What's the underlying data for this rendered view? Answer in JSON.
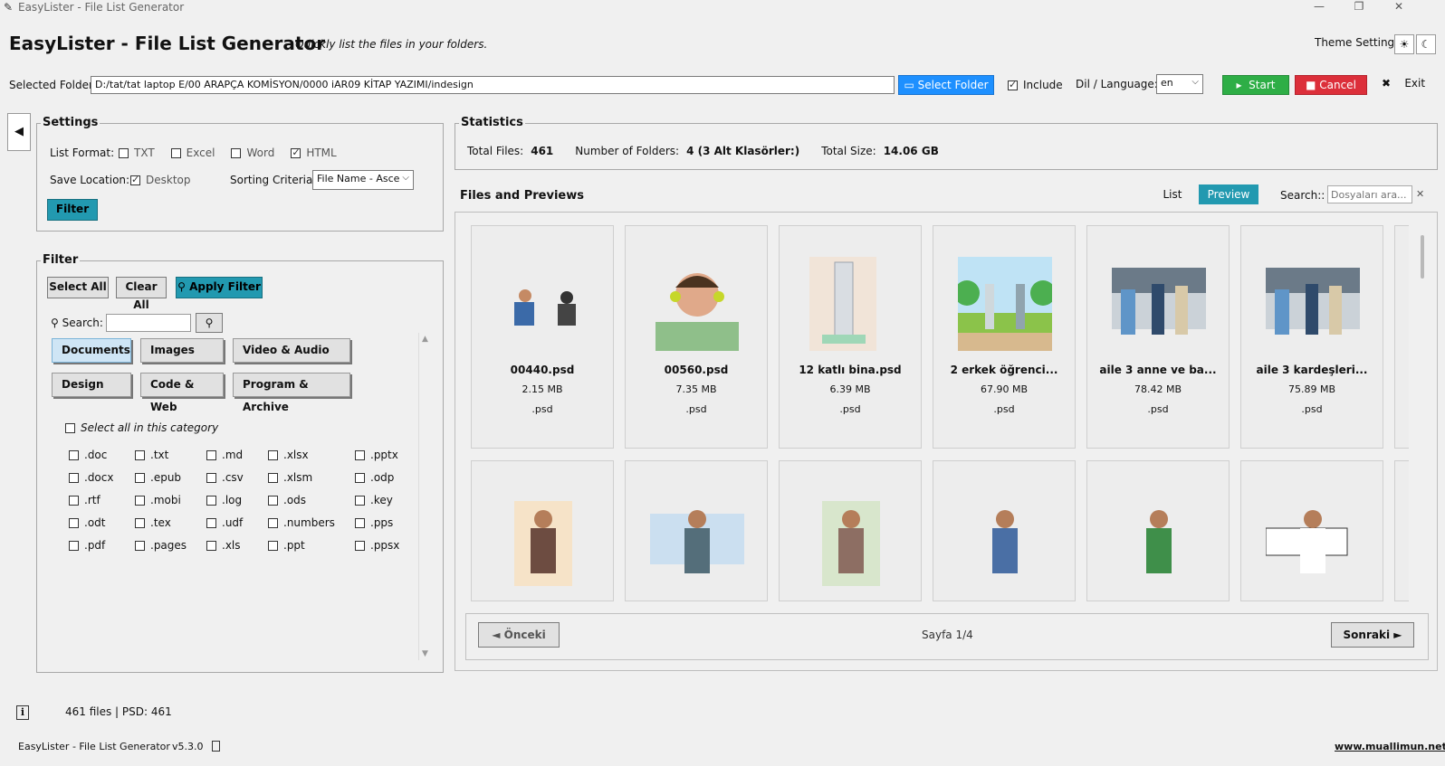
{
  "window": {
    "title": "EasyLister - File List Generator",
    "controls": [
      "—",
      "❐",
      "✕"
    ]
  },
  "header": {
    "title": "EasyLister - File List Generator",
    "subtitle": "- Quickly list the files in your folders.",
    "theme_label": "Theme Settings",
    "theme_light_icon": "☀",
    "theme_dark_icon": "☾"
  },
  "toolbar": {
    "selected_folder_label": "Selected Folder:",
    "selected_folder_path": "D:/tat/tat laptop E/00 ARAPÇA KOMİSYON/0000 iAR09 KİTAP YAZIMI/indesign",
    "select_folder_button": "Select Folder",
    "include_label": "Include",
    "language_label": "Dil / Language:",
    "language_value": "en",
    "start_button": "Start",
    "cancel_button": "Cancel",
    "exit_icon": "✖",
    "exit_label": "Exit"
  },
  "settings": {
    "title": "Settings",
    "list_format_label": "List Format:",
    "formats": [
      {
        "label": "TXT",
        "checked": false
      },
      {
        "label": "Excel",
        "checked": false
      },
      {
        "label": "Word",
        "checked": false
      },
      {
        "label": "HTML",
        "checked": true
      }
    ],
    "save_location_label": "Save Location:",
    "save_location_option": "Desktop",
    "sorting_label": "Sorting Criteria:",
    "sorting_value": "File Name - Asce",
    "filter_button": "Filter"
  },
  "filter": {
    "title": "Filter",
    "select_all": "Select All",
    "clear_all": "Clear All",
    "apply_filter": "Apply Filter",
    "search_label": "Search:",
    "categories": [
      "Documents",
      "Images",
      "Video & Audio",
      "Design",
      "Code & Web",
      "Program & Archive"
    ],
    "active_category": "Documents",
    "select_all_category": "Select all in this category",
    "extensions": [
      [
        ".doc",
        ".txt",
        ".md",
        ".xlsx",
        ".pptx"
      ],
      [
        ".docx",
        ".epub",
        ".csv",
        ".xlsm",
        ".odp"
      ],
      [
        ".rtf",
        ".mobi",
        ".log",
        ".ods",
        ".key"
      ],
      [
        ".odt",
        ".tex",
        ".udf",
        ".numbers",
        ".pps"
      ],
      [
        ".pdf",
        ".pages",
        ".xls",
        ".ppt",
        ".ppsx"
      ]
    ]
  },
  "statistics": {
    "title": "Statistics",
    "total_files_label": "Total Files:",
    "total_files": "461",
    "folders_label": "Number of Folders:",
    "folders": "4 (3 Alt Klasörler:)",
    "size_label": "Total Size:",
    "size": "14.06 GB"
  },
  "preview": {
    "title": "Files and Previews",
    "tab_list": "List",
    "tab_preview": "Preview",
    "search_label": "Search::",
    "search_placeholder": "Dosyaları ara...",
    "clear_icon": "✕",
    "files": [
      {
        "name": "00440.psd",
        "size": "2.15 MB",
        "ext": ".psd"
      },
      {
        "name": "00560.psd",
        "size": "7.35 MB",
        "ext": ".psd"
      },
      {
        "name": "12 katlı bina.psd",
        "size": "6.39 MB",
        "ext": ".psd"
      },
      {
        "name": "2 erkek öğrenci...",
        "size": "67.90 MB",
        "ext": ".psd"
      },
      {
        "name": "aile 3 anne ve ba...",
        "size": "78.42 MB",
        "ext": ".psd"
      },
      {
        "name": "aile 3 kardeşleri...",
        "size": "75.89 MB",
        "ext": ".psd"
      }
    ],
    "prev_button": "◄ Önceki",
    "page_label": "Sayfa 1/4",
    "next_button": "Sonraki ►"
  },
  "status": {
    "info_icon": "i",
    "text": "461 files | PSD: 461"
  },
  "footer": {
    "app": "EasyLister - File List Generator",
    "version": "v5.3.0",
    "link": "www.muallimun.net"
  }
}
